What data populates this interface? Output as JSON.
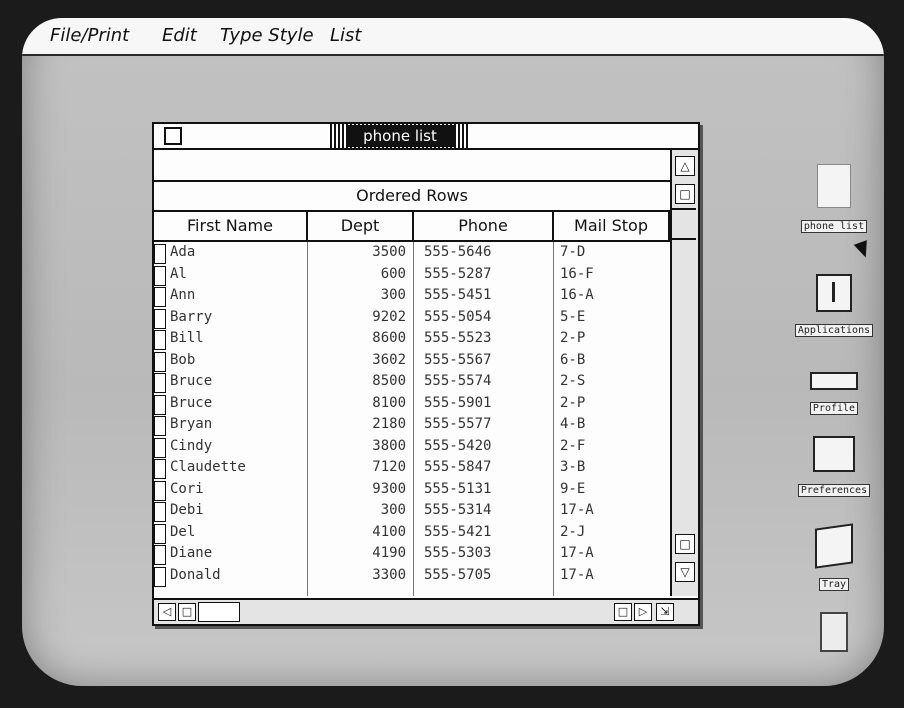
{
  "menubar": {
    "items": [
      "File/Print",
      "Edit",
      "Type Style",
      "List"
    ]
  },
  "window": {
    "title": "phone list",
    "section_label": "Ordered Rows",
    "columns": [
      "First Name",
      "Dept",
      "Phone",
      "Mail Stop"
    ],
    "rows": [
      {
        "first": "Ada",
        "dept": "3500",
        "phone": "555-5646",
        "mail": "7-D"
      },
      {
        "first": "Al",
        "dept": "600",
        "phone": "555-5287",
        "mail": "16-F"
      },
      {
        "first": "Ann",
        "dept": "300",
        "phone": "555-5451",
        "mail": "16-A"
      },
      {
        "first": "Barry",
        "dept": "9202",
        "phone": "555-5054",
        "mail": "5-E"
      },
      {
        "first": "Bill",
        "dept": "8600",
        "phone": "555-5523",
        "mail": "2-P"
      },
      {
        "first": "Bob",
        "dept": "3602",
        "phone": "555-5567",
        "mail": "6-B"
      },
      {
        "first": "Bruce",
        "dept": "8500",
        "phone": "555-5574",
        "mail": "2-S"
      },
      {
        "first": "Bruce",
        "dept": "8100",
        "phone": "555-5901",
        "mail": "2-P"
      },
      {
        "first": "Bryan",
        "dept": "2180",
        "phone": "555-5577",
        "mail": "4-B"
      },
      {
        "first": "Cindy",
        "dept": "3800",
        "phone": "555-5420",
        "mail": "2-F"
      },
      {
        "first": "Claudette",
        "dept": "7120",
        "phone": "555-5847",
        "mail": "3-B"
      },
      {
        "first": "Cori",
        "dept": "9300",
        "phone": "555-5131",
        "mail": "9-E"
      },
      {
        "first": "Debi",
        "dept": "300",
        "phone": "555-5314",
        "mail": "17-A"
      },
      {
        "first": "Del",
        "dept": "4100",
        "phone": "555-5421",
        "mail": "2-J"
      },
      {
        "first": "Diane",
        "dept": "4190",
        "phone": "555-5303",
        "mail": "17-A"
      },
      {
        "first": "Donald",
        "dept": "3300",
        "phone": "555-5705",
        "mail": "17-A"
      }
    ]
  },
  "desktop_icons": [
    {
      "label": "phone list",
      "icon": "document-icon"
    },
    {
      "label": "Applications",
      "icon": "applications-folder-icon"
    },
    {
      "label": "Profile",
      "icon": "profile-disk-icon"
    },
    {
      "label": "Preferences",
      "icon": "preferences-icon"
    },
    {
      "label": "Tray",
      "icon": "tray-icon"
    },
    {
      "label": "",
      "icon": "wastebasket-icon"
    }
  ]
}
